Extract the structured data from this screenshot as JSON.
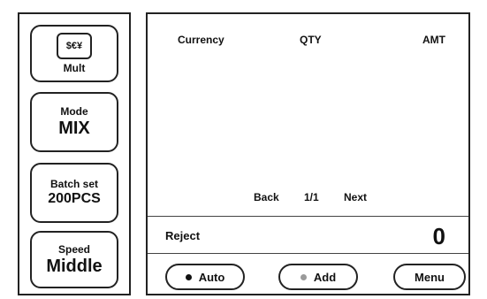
{
  "left_panel": {
    "mult": {
      "icon": "currency-notes-icon",
      "icon_text": "$€¥",
      "label": "Mult"
    },
    "mode": {
      "title": "Mode",
      "value": "MIX"
    },
    "batch": {
      "title": "Batch set",
      "value": "200PCS"
    },
    "speed": {
      "title": "Speed",
      "value": "Middle"
    }
  },
  "table": {
    "headers": [
      "Currency",
      "QTY",
      "AMT"
    ]
  },
  "pager": {
    "back": "Back",
    "page": "1/1",
    "next": "Next"
  },
  "reject": {
    "label": "Reject",
    "count": "0"
  },
  "actions": {
    "auto": "Auto",
    "add": "Add",
    "menu": "Menu"
  },
  "colors": {
    "add_dot": "#9a9a9a",
    "auto_dot": "#111111"
  }
}
